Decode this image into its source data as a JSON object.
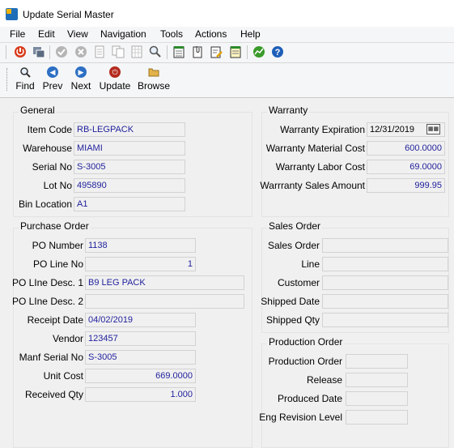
{
  "window": {
    "title": "Update Serial Master"
  },
  "menu": [
    "File",
    "Edit",
    "View",
    "Navigation",
    "Tools",
    "Actions",
    "Help"
  ],
  "toolbar_icons": [
    "power-icon",
    "copy-window-icon",
    "check-icon",
    "cancel-icon",
    "document-icon",
    "document-copy-icon",
    "document-grid-icon",
    "magnifier-icon",
    "notepad-icon",
    "clip-document-icon",
    "edit-note-icon",
    "calendar-note-icon",
    "chart-icon",
    "help-icon"
  ],
  "nav": {
    "find": "Find",
    "prev": "Prev",
    "next": "Next",
    "update": "Update",
    "browse": "Browse"
  },
  "general": {
    "title": "General",
    "item_code_label": "Item Code",
    "item_code": "RB-LEGPACK",
    "warehouse_label": "Warehouse",
    "warehouse": "MIAMI",
    "serial_no_label": "Serial No",
    "serial_no": "S-3005",
    "lot_no_label": "Lot No",
    "lot_no": "495890",
    "bin_location_label": "Bin Location",
    "bin_location": "A1"
  },
  "warranty": {
    "title": "Warranty",
    "expiration_label": "Warranty Expiration",
    "expiration": "12/31/2019",
    "material_cost_label": "Warranty Material Cost",
    "material_cost": "600.0000",
    "labor_cost_label": "Warranty Labor Cost",
    "labor_cost": "69.0000",
    "sales_amount_label": "Warrranty Sales Amount",
    "sales_amount": "999.95"
  },
  "purchase_order": {
    "title": "Purchase Order",
    "po_number_label": "PO Number",
    "po_number": "1138",
    "po_line_no_label": "PO Line No",
    "po_line_no": "1",
    "desc1_label": "PO LIne Desc. 1",
    "desc1": "B9 LEG PACK",
    "desc2_label": "PO LIne Desc. 2",
    "desc2": "",
    "receipt_date_label": "Receipt Date",
    "receipt_date": "04/02/2019",
    "vendor_label": "Vendor",
    "vendor": "123457",
    "manf_serial_label": "Manf Serial No",
    "manf_serial": "S-3005",
    "unit_cost_label": "Unit Cost",
    "unit_cost": "669.0000",
    "received_qty_label": "Received Qty",
    "received_qty": "1.000"
  },
  "sales_order": {
    "title": "Sales Order",
    "sales_order_label": "Sales Order",
    "sales_order": "",
    "line_label": "Line",
    "line": "",
    "customer_label": "Customer",
    "customer": "",
    "shipped_date_label": "Shipped Date",
    "shipped_date": "",
    "shipped_qty_label": "Shipped Qty",
    "shipped_qty": ""
  },
  "production_order": {
    "title": "Production Order",
    "production_order_label": "Production Order",
    "production_order": "",
    "release_label": "Release",
    "release": "",
    "produced_date_label": "Produced Date",
    "produced_date": "",
    "eng_revision_label": "Eng Revision Level",
    "eng_revision": ""
  },
  "colors": {
    "value_text": "#1f1f9c",
    "background": "#f0f0f0",
    "border": "#d2d2d2"
  }
}
